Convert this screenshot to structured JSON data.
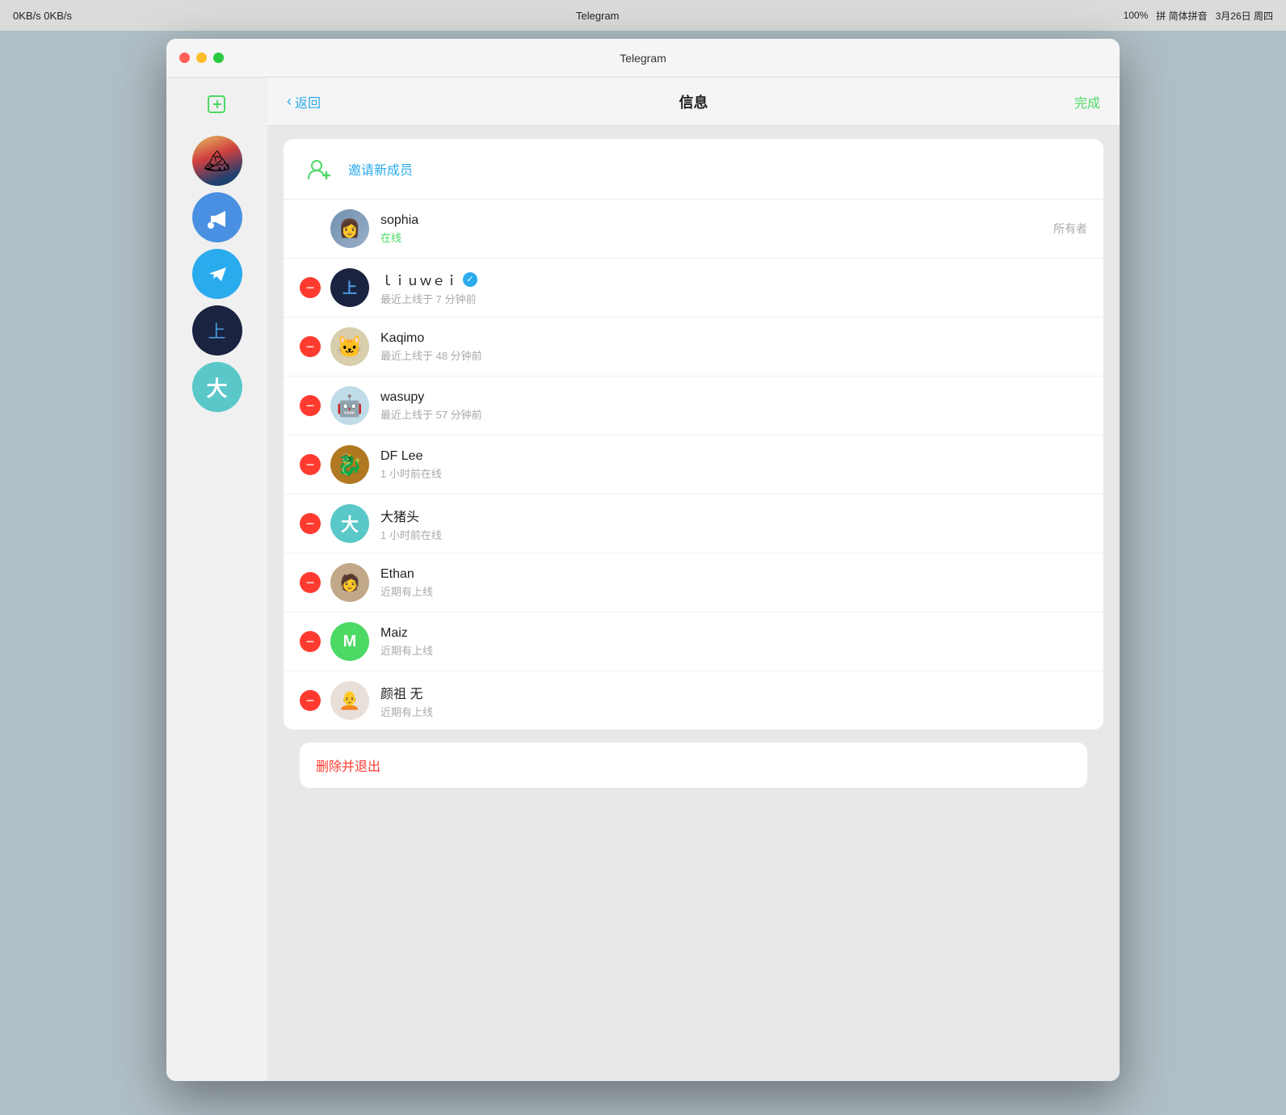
{
  "menubar": {
    "title": "Telegram",
    "date": "3月26日 周四",
    "network": "0KB/s 0KB/s",
    "battery": "100%",
    "input": "拼 简体拼音"
  },
  "titlebar": {
    "title": "Telegram"
  },
  "header": {
    "back_label": "返回",
    "title": "信息",
    "done_label": "完成"
  },
  "invite": {
    "label": "邀请新成员"
  },
  "members": [
    {
      "name": "sophia",
      "status": "在线",
      "status_type": "online",
      "role": "所有者",
      "avatar_color": "#8899aa",
      "avatar_text": "",
      "is_owner": true,
      "removable": false
    },
    {
      "name": "ｌｉｕｗｅｉ",
      "status": "最近上线于 7 分钟前",
      "status_type": "offline",
      "role": "",
      "avatar_color": "#1a2340",
      "avatar_text": "上",
      "is_owner": false,
      "removable": true,
      "verified": true
    },
    {
      "name": "Kaqimo",
      "status": "最近上线于 48 分钟前",
      "status_type": "offline",
      "role": "",
      "avatar_color": "#d0c8b0",
      "avatar_text": "🐱",
      "is_owner": false,
      "removable": true
    },
    {
      "name": "wasupy",
      "status": "最近上线于 57 分钟前",
      "status_type": "offline",
      "role": "",
      "avatar_color": "#b0d8e8",
      "avatar_text": "🤖",
      "is_owner": false,
      "removable": true
    },
    {
      "name": "DF Lee",
      "status": "1 小时前在线",
      "status_type": "offline",
      "role": "",
      "avatar_color": "#c8781c",
      "avatar_text": "🐉",
      "is_owner": false,
      "removable": true
    },
    {
      "name": "大猪头",
      "status": "1 小时前在线",
      "status_type": "offline",
      "role": "",
      "avatar_color": "#5ac8c8",
      "avatar_text": "大",
      "is_owner": false,
      "removable": true
    },
    {
      "name": "Ethan",
      "status": "近期有上线",
      "status_type": "offline",
      "role": "",
      "avatar_color": "#b09070",
      "avatar_text": "",
      "is_owner": false,
      "removable": true
    },
    {
      "name": "Maiz",
      "status": "近期有上线",
      "status_type": "offline",
      "role": "",
      "avatar_color": "#4cd964",
      "avatar_text": "M",
      "is_owner": false,
      "removable": true
    },
    {
      "name": "颜祖 无",
      "status": "近期有上线",
      "status_type": "offline",
      "role": "",
      "avatar_color": "#e0e0e0",
      "avatar_text": "🧑",
      "is_owner": false,
      "removable": true
    }
  ],
  "delete_label": "删除并退出",
  "sidebar": {
    "items": [
      {
        "label": "大",
        "color": "#5ac8c8",
        "type": "teal"
      },
      {
        "label": "",
        "color": "#1a2340",
        "type": "dark"
      },
      {
        "label": "",
        "color": "#2aabee",
        "type": "telegram"
      },
      {
        "label": "",
        "color": "#4a90e2",
        "type": "megaphone"
      },
      {
        "label": "",
        "color": "green-avatar",
        "type": "avatar"
      }
    ]
  }
}
